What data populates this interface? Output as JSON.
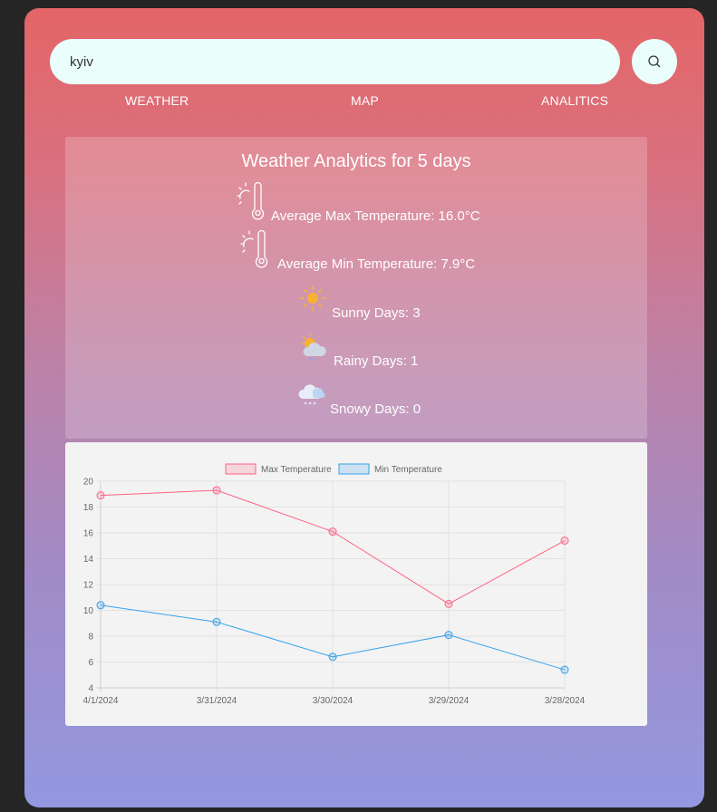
{
  "search": {
    "value": "kyiv",
    "button_icon": "search-icon"
  },
  "nav": {
    "items": [
      "WEATHER",
      "MAP",
      "ANALITICS"
    ]
  },
  "analytics": {
    "title": "Weather Analytics for 5 days",
    "stats": [
      {
        "label": "Average Max Temperature: 16.0°C",
        "icon": "thermometer-sun-icon"
      },
      {
        "label": "Average Min Temperature: 7.9°C",
        "icon": "thermometer-sun-icon"
      },
      {
        "label": "Sunny Days: 3",
        "icon": "sun-icon"
      },
      {
        "label": "Rainy Days: 1",
        "icon": "sun-rain-cloud-icon"
      },
      {
        "label": "Snowy Days: 0",
        "icon": "snow-cloud-icon"
      }
    ]
  },
  "colors": {
    "max_line": "#ff6384",
    "min_line": "#36a2eb"
  },
  "chart_data": {
    "type": "line",
    "x": [
      "4/1/2024",
      "3/31/2024",
      "3/30/2024",
      "3/29/2024",
      "3/28/2024"
    ],
    "series": [
      {
        "name": "Max Temperature",
        "values": [
          18.9,
          19.3,
          16.1,
          10.5,
          15.4
        ]
      },
      {
        "name": "Min Temperature",
        "values": [
          10.4,
          9.1,
          6.4,
          8.1,
          5.4
        ]
      }
    ],
    "ylim": [
      4,
      20
    ],
    "yticks": [
      4,
      6,
      8,
      10,
      12,
      14,
      16,
      18,
      20
    ],
    "grid": true,
    "legend": "top"
  }
}
